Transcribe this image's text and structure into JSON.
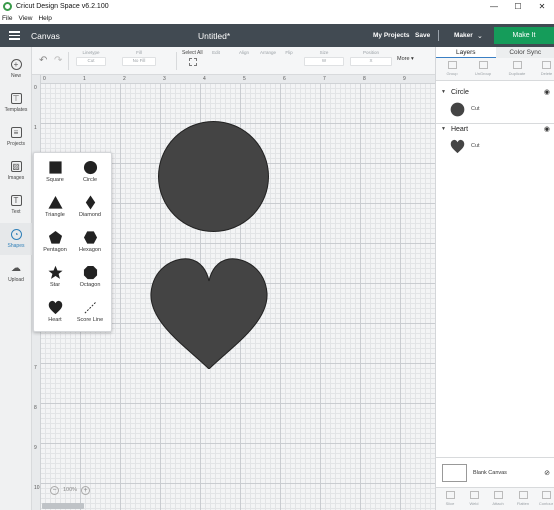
{
  "window": {
    "title": "Cricut Design Space  v6.2.100",
    "menu": [
      "File",
      "View",
      "Help"
    ]
  },
  "header": {
    "section": "Canvas",
    "doc_title": "Untitled*",
    "my_projects": "My Projects",
    "save": "Save",
    "machine": "Maker",
    "make_it": "Make It"
  },
  "toolbar": {
    "groups": [
      "Linetype",
      "Fill",
      "Select All",
      "Edit",
      "Align",
      "Arrange",
      "Flip",
      "Size",
      "Rotate",
      "Position"
    ],
    "linetype_value": "Cut",
    "fill_value": "No Fill",
    "size_w": "W",
    "size_h": "H",
    "position_x": "X",
    "position_y": "Y",
    "more": "More"
  },
  "sidebar": {
    "items": [
      {
        "label": "New",
        "icon": "plus-icon"
      },
      {
        "label": "Templates",
        "icon": "shirt-icon"
      },
      {
        "label": "Projects",
        "icon": "projects-icon"
      },
      {
        "label": "Images",
        "icon": "image-icon"
      },
      {
        "label": "Text",
        "icon": "text-icon"
      },
      {
        "label": "Shapes",
        "icon": "shapes-icon"
      },
      {
        "label": "Upload",
        "icon": "upload-icon"
      }
    ]
  },
  "shapes_panel": {
    "items": [
      "Square",
      "Circle",
      "Triangle",
      "Diamond",
      "Pentagon",
      "Hexagon",
      "Star",
      "Octagon",
      "Heart",
      "Score Line"
    ]
  },
  "canvas": {
    "ruler_top": [
      "0",
      "1",
      "2",
      "3",
      "4",
      "5",
      "6",
      "7",
      "8",
      "9"
    ],
    "ruler_left": [
      "0",
      "1",
      "2",
      "3",
      "4",
      "5",
      "6",
      "7",
      "8",
      "9",
      "10",
      "11"
    ],
    "zoom": "100%",
    "shape_fill": "#444444"
  },
  "layers_panel": {
    "tabs": [
      "Layers",
      "Color Sync"
    ],
    "tools": [
      "Group",
      "UnGroup",
      "Duplicate",
      "Delete"
    ],
    "layers": [
      {
        "name": "Circle",
        "operation": "Cut"
      },
      {
        "name": "Heart",
        "operation": "Cut"
      }
    ],
    "blank_canvas": "Blank Canvas",
    "bottom_tools": [
      "Slice",
      "Weld",
      "Attach",
      "Flatten",
      "Contour"
    ]
  },
  "colors": {
    "header": "#414a52",
    "make_it": "#159c5a",
    "active_sidebar": "#2f7fb8"
  }
}
